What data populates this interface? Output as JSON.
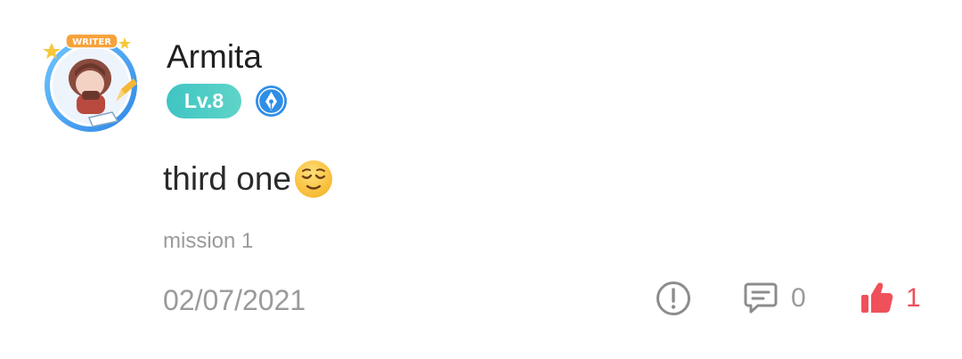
{
  "post": {
    "author": {
      "name": "Armita",
      "level": "Lv.8",
      "avatar_frame_text": "WRITER",
      "writer_badge_icon": "fountain-pen-nib-icon"
    },
    "message_text": "third one",
    "message_emoji": "relieved-face-emoji",
    "tag": "mission 1",
    "date": "02/07/2021",
    "actions": {
      "report_icon": "exclamation-circle-icon",
      "comment_icon": "comment-bubble-icon",
      "comment_count": "0",
      "like_icon": "thumbs-up-icon",
      "like_count": "1"
    }
  },
  "colors": {
    "level_pill": "#4fcfc6",
    "writer_badge": "#2f8ee8",
    "like_accent": "#f0505a",
    "muted_text": "#9a9a9a",
    "icon_gray": "#8c8c8c"
  }
}
